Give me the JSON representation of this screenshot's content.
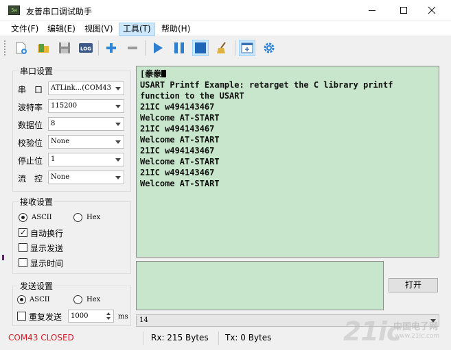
{
  "window": {
    "title": "友善串口调试助手",
    "icon_text": "5w",
    "minimize_icon": "minimize-icon",
    "maximize_icon": "maximize-icon",
    "close_icon": "close-icon"
  },
  "menu": [
    {
      "label": "文件(F)"
    },
    {
      "label": "编辑(E)"
    },
    {
      "label": "视图(V)"
    },
    {
      "label": "工具(T)",
      "active": true
    },
    {
      "label": "帮助(H)"
    }
  ],
  "toolbar": {
    "icons": [
      "new-icon",
      "open-folder-icon",
      "save-icon",
      "log-icon",
      "add-icon",
      "remove-icon",
      "run-icon",
      "pause-icon",
      "stop-icon",
      "clear-broom-icon",
      "add-window-icon",
      "settings-gear-icon"
    ],
    "log_text": "LOG"
  },
  "serial": {
    "title": "串口设置",
    "port_label": "串　口",
    "port_value": "ATLink...(COM43",
    "baud_label": "波特率",
    "baud_value": "115200",
    "databits_label": "数据位",
    "databits_value": "8",
    "parity_label": "校验位",
    "parity_value": "None",
    "stopbits_label": "停止位",
    "stopbits_value": "1",
    "flow_label": "流　控",
    "flow_value": "None"
  },
  "receive": {
    "title": "接收设置",
    "ascii_label": "ASCII",
    "hex_label": "Hex",
    "mode": "ASCII",
    "auto_wrap_label": "自动换行",
    "auto_wrap": true,
    "show_send_label": "显示发送",
    "show_send": false,
    "show_time_label": "显示时间",
    "show_time": false
  },
  "send": {
    "title": "发送设置",
    "ascii_label": "ASCII",
    "hex_label": "Hex",
    "mode": "ASCII",
    "repeat_label": "重复发送",
    "repeat": false,
    "interval_value": "1000",
    "interval_unit": "ms"
  },
  "terminal": {
    "lines": [
      "[豢豢",
      "USART Printf Example: retarget the C library printf",
      "function to the USART",
      "21IC w494143467",
      "Welcome AT-START",
      "21IC w494143467",
      "Welcome AT-START",
      "21IC w494143467",
      "Welcome AT-START",
      "21IC w494143467",
      "Welcome AT-START"
    ],
    "background": "#c7e6cb"
  },
  "open_button_label": "打开",
  "history_value": "14",
  "status": {
    "port_status": "COM43 CLOSED",
    "port_status_color": "#d0202a",
    "rx": "Rx: 215 Bytes",
    "tx": "Tx: 0 Bytes"
  },
  "watermark": {
    "main": "21ic",
    "sub": "中国电子网",
    "sub2": "www.21ic.com"
  }
}
